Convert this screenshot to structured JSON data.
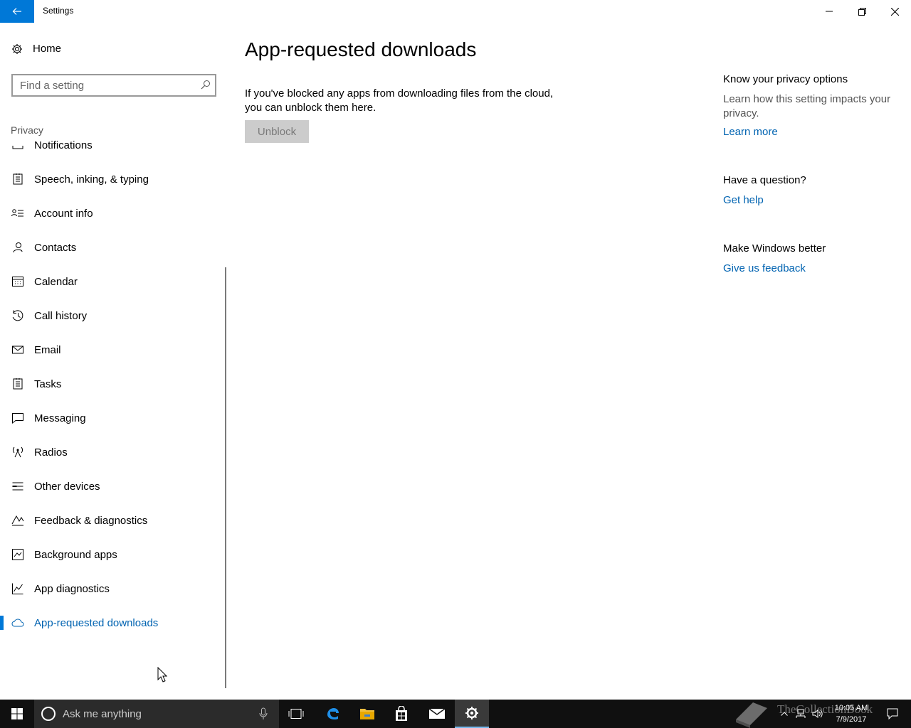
{
  "window": {
    "title": "Settings",
    "accent_color": "#0078d7"
  },
  "sidebar": {
    "home_label": "Home",
    "search_placeholder": "Find a setting",
    "section_title": "Privacy",
    "items": [
      {
        "label": "Notifications",
        "icon": "notifications-icon"
      },
      {
        "label": "Speech, inking, & typing",
        "icon": "speech-icon"
      },
      {
        "label": "Account info",
        "icon": "account-info-icon"
      },
      {
        "label": "Contacts",
        "icon": "contacts-icon"
      },
      {
        "label": "Calendar",
        "icon": "calendar-icon"
      },
      {
        "label": "Call history",
        "icon": "call-history-icon"
      },
      {
        "label": "Email",
        "icon": "email-icon"
      },
      {
        "label": "Tasks",
        "icon": "tasks-icon"
      },
      {
        "label": "Messaging",
        "icon": "messaging-icon"
      },
      {
        "label": "Radios",
        "icon": "radios-icon"
      },
      {
        "label": "Other devices",
        "icon": "other-devices-icon"
      },
      {
        "label": "Feedback & diagnostics",
        "icon": "feedback-icon"
      },
      {
        "label": "Background apps",
        "icon": "background-apps-icon"
      },
      {
        "label": "App diagnostics",
        "icon": "app-diagnostics-icon"
      },
      {
        "label": "App-requested downloads",
        "icon": "cloud-icon",
        "active": true
      }
    ]
  },
  "main": {
    "title": "App-requested downloads",
    "description": "If you've blocked any apps from downloading files from the cloud, you can unblock them here.",
    "unblock_label": "Unblock"
  },
  "aside": {
    "privacy_heading": "Know your privacy options",
    "privacy_text": "Learn how this setting impacts your privacy.",
    "learn_more": "Learn more",
    "question_heading": "Have a question?",
    "get_help": "Get help",
    "better_heading": "Make Windows better",
    "feedback_link": "Give us feedback"
  },
  "taskbar": {
    "search_placeholder": "Ask me anything",
    "time": "10:05 AM",
    "date": "7/9/2017",
    "watermark": "TheCollectionBook"
  }
}
